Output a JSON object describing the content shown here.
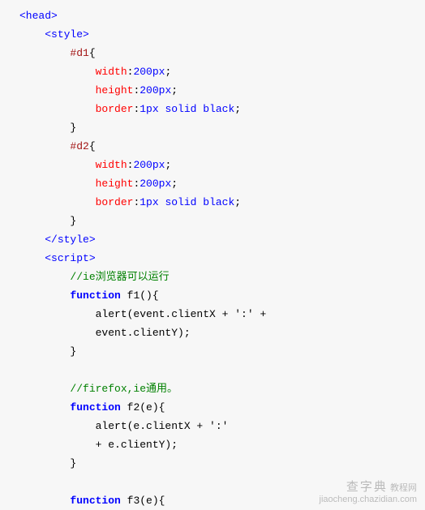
{
  "lines": [
    [
      {
        "c": "tag",
        "t": "<head>"
      }
    ],
    [
      {
        "c": "txt",
        "t": "    "
      },
      {
        "c": "tag",
        "t": "<style>"
      }
    ],
    [
      {
        "c": "txt",
        "t": "        "
      },
      {
        "c": "sel",
        "t": "#d1"
      },
      {
        "c": "txt",
        "t": "{"
      }
    ],
    [
      {
        "c": "txt",
        "t": "            "
      },
      {
        "c": "prop",
        "t": "width"
      },
      {
        "c": "txt",
        "t": ":"
      },
      {
        "c": "cssval",
        "t": "200px"
      },
      {
        "c": "txt",
        "t": ";"
      }
    ],
    [
      {
        "c": "txt",
        "t": "            "
      },
      {
        "c": "prop",
        "t": "height"
      },
      {
        "c": "txt",
        "t": ":"
      },
      {
        "c": "cssval",
        "t": "200px"
      },
      {
        "c": "txt",
        "t": ";"
      }
    ],
    [
      {
        "c": "txt",
        "t": "            "
      },
      {
        "c": "prop",
        "t": "border"
      },
      {
        "c": "txt",
        "t": ":"
      },
      {
        "c": "cssval",
        "t": "1px solid black"
      },
      {
        "c": "txt",
        "t": ";"
      }
    ],
    [
      {
        "c": "txt",
        "t": "        "
      },
      {
        "c": "txt",
        "t": "}"
      }
    ],
    [
      {
        "c": "txt",
        "t": "        "
      },
      {
        "c": "sel",
        "t": "#d2"
      },
      {
        "c": "txt",
        "t": "{"
      }
    ],
    [
      {
        "c": "txt",
        "t": "            "
      },
      {
        "c": "prop",
        "t": "width"
      },
      {
        "c": "txt",
        "t": ":"
      },
      {
        "c": "cssval",
        "t": "200px"
      },
      {
        "c": "txt",
        "t": ";"
      }
    ],
    [
      {
        "c": "txt",
        "t": "            "
      },
      {
        "c": "prop",
        "t": "height"
      },
      {
        "c": "txt",
        "t": ":"
      },
      {
        "c": "cssval",
        "t": "200px"
      },
      {
        "c": "txt",
        "t": ";"
      }
    ],
    [
      {
        "c": "txt",
        "t": "            "
      },
      {
        "c": "prop",
        "t": "border"
      },
      {
        "c": "txt",
        "t": ":"
      },
      {
        "c": "cssval",
        "t": "1px solid black"
      },
      {
        "c": "txt",
        "t": ";"
      }
    ],
    [
      {
        "c": "txt",
        "t": "        "
      },
      {
        "c": "txt",
        "t": "}"
      }
    ],
    [
      {
        "c": "txt",
        "t": "    "
      },
      {
        "c": "tag",
        "t": "</style>"
      }
    ],
    [
      {
        "c": "txt",
        "t": "    "
      },
      {
        "c": "tag",
        "t": "<script>"
      }
    ],
    [
      {
        "c": "txt",
        "t": "        "
      },
      {
        "c": "comment",
        "t": "//ie浏览器可以运行"
      }
    ],
    [
      {
        "c": "txt",
        "t": "        "
      },
      {
        "c": "kw",
        "t": "function"
      },
      {
        "c": "txt",
        "t": " f1(){"
      }
    ],
    [
      {
        "c": "txt",
        "t": "            alert(event.clientX + ':' + "
      }
    ],
    [
      {
        "c": "txt",
        "t": "            event.clientY);"
      }
    ],
    [
      {
        "c": "txt",
        "t": "        }"
      }
    ],
    [
      {
        "c": "txt",
        "t": "        "
      }
    ],
    [
      {
        "c": "txt",
        "t": "        "
      },
      {
        "c": "comment",
        "t": "//firefox,ie通用。"
      }
    ],
    [
      {
        "c": "txt",
        "t": "        "
      },
      {
        "c": "kw",
        "t": "function"
      },
      {
        "c": "txt",
        "t": " f2(e){"
      }
    ],
    [
      {
        "c": "txt",
        "t": "            alert(e.clientX + ':' "
      }
    ],
    [
      {
        "c": "txt",
        "t": "            + e.clientY);"
      }
    ],
    [
      {
        "c": "txt",
        "t": "        }"
      }
    ],
    [
      {
        "c": "txt",
        "t": "        "
      }
    ],
    [
      {
        "c": "txt",
        "t": "        "
      },
      {
        "c": "kw",
        "t": "function"
      },
      {
        "c": "txt",
        "t": " f3(e){"
      }
    ]
  ],
  "watermark": {
    "brand": "查字典",
    "sub": "教程网",
    "url": "jiaocheng.chazidian.com"
  }
}
